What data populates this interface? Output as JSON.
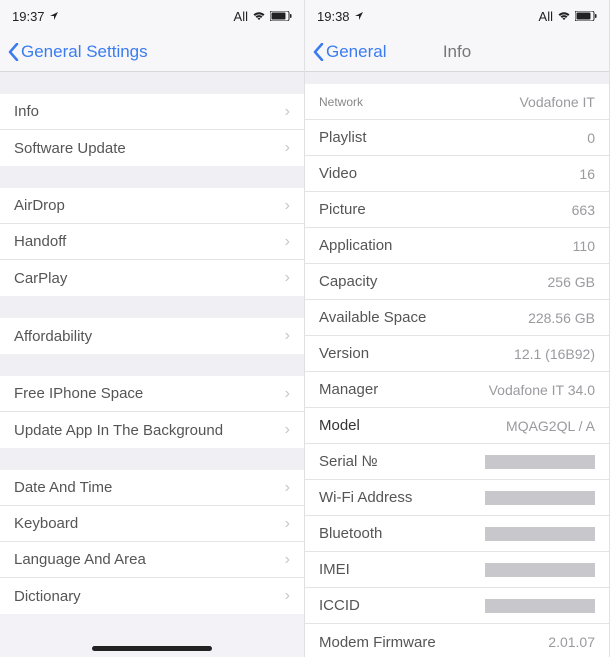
{
  "left": {
    "status": {
      "time": "19:37",
      "carrier": "All"
    },
    "nav": {
      "back": "General Settings"
    },
    "groups": [
      [
        {
          "label": "Info"
        },
        {
          "label": "Software Update"
        }
      ],
      [
        {
          "label": "AirDrop"
        },
        {
          "label": "Handoff"
        },
        {
          "label": "CarPlay"
        }
      ],
      [
        {
          "label": "Affordability"
        }
      ],
      [
        {
          "label": "Free IPhone Space"
        },
        {
          "label": "Update App In The Background"
        }
      ],
      [
        {
          "label": "Date And Time"
        },
        {
          "label": "Keyboard"
        },
        {
          "label": "Language And Area"
        },
        {
          "label": "Dictionary"
        }
      ]
    ]
  },
  "right": {
    "status": {
      "time": "19:38",
      "carrier": "All"
    },
    "nav": {
      "back": "General",
      "title": "Info"
    },
    "rows": [
      {
        "label": "Network",
        "value": "Vodafone IT",
        "small": true
      },
      {
        "label": "Playlist",
        "value": "0"
      },
      {
        "label": "Video",
        "value": "16"
      },
      {
        "label": "Picture",
        "value": "663"
      },
      {
        "label": "Application",
        "value": "110"
      },
      {
        "label": "Capacity",
        "value": "256 GB"
      },
      {
        "label": "Available Space",
        "value": "228.56 GB"
      },
      {
        "label": "Version",
        "value": "12.1 (16B92)"
      },
      {
        "label": "Manager",
        "value": "Vodafone IT 34.0"
      },
      {
        "label": "Model",
        "value": "MQAG2QL / A",
        "strong": true
      },
      {
        "label": "Serial №",
        "redacted": true
      },
      {
        "label": "Wi-Fi Address",
        "redacted": true
      },
      {
        "label": "Bluetooth",
        "redacted": true
      },
      {
        "label": "IMEI",
        "redacted": true
      },
      {
        "label": "ICCID",
        "redacted": true
      },
      {
        "label": "Modem Firmware",
        "value": "2.01.07"
      }
    ]
  }
}
